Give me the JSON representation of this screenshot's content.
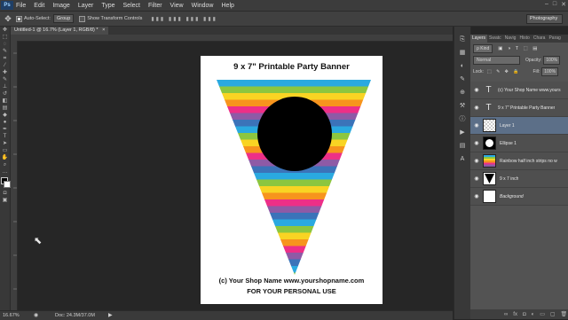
{
  "menubar": {
    "logo": "Ps",
    "items": [
      "File",
      "Edit",
      "Image",
      "Layer",
      "Type",
      "Select",
      "Filter",
      "View",
      "Window",
      "Help"
    ],
    "window_controls": [
      "–",
      "□",
      "✕"
    ]
  },
  "options": {
    "auto_select_label": "Auto-Select:",
    "auto_select_value": "Group",
    "show_transform_label": "Show Transform Controls",
    "workspace": "Photography"
  },
  "document": {
    "tab_label": "Untitled-1 @ 16.7% (Layer 1, RGB/8) *",
    "tab_close": "×",
    "title": "9 x 7\" Printable Party Banner",
    "footer_line1": "(c) Your Shop Name www.yourshopname.com",
    "footer_line2": "FOR YOUR PERSONAL USE",
    "stripe_colors": [
      "#2aa9e0",
      "#8cc63f",
      "#f9d423",
      "#f7941d",
      "#ed2f87",
      "#8e5aa6",
      "#3b73b9"
    ]
  },
  "status": {
    "zoom": "16.67%",
    "doc": "Doc: 24.3M/37.0M"
  },
  "layers_panel": {
    "tabs": [
      "Layers",
      "Swatc",
      "Navig",
      "Histo",
      "Chara",
      "Parag"
    ],
    "kind_label": "ρ Kind",
    "blend_mode": "Normal",
    "opacity_label": "Opacity:",
    "opacity_value": "100%",
    "lock_label": "Lock:",
    "fill_label": "Fill:",
    "fill_value": "100%",
    "layers": [
      {
        "name": "(c) Your Shop Name www.yours",
        "type": "text"
      },
      {
        "name": "9 x 7\" Printable Party Banner",
        "type": "text"
      },
      {
        "name": "Layer 1",
        "type": "checker",
        "selected": true
      },
      {
        "name": "Ellipse 1",
        "type": "ellipse"
      },
      {
        "name": "Rainbow half inch strips no w",
        "type": "stripes"
      },
      {
        "name": "9 x 7 inch",
        "type": "triangle"
      },
      {
        "name": "Background",
        "type": "white"
      }
    ]
  }
}
